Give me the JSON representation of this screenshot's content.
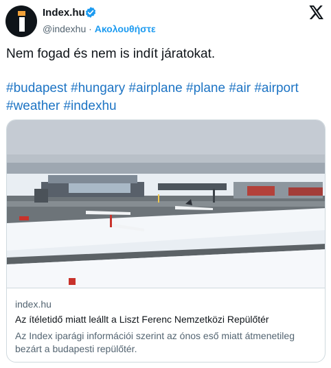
{
  "account": {
    "name": "Index.hu",
    "handle": "@indexhu",
    "separator": "·",
    "follow_label": "Ακολουθήστε",
    "verified_icon": "verified-badge-icon",
    "avatar_icon": "index-logo"
  },
  "brand": {
    "logo_icon": "x-logo-icon",
    "accent": "#1d9bf0",
    "text": "#0f1419",
    "muted": "#536471"
  },
  "tweet": {
    "text": "Nem fogad és nem is indít járatokat.",
    "hashtags": [
      "#budapest",
      "#hungary",
      "#airplane",
      "#plane",
      "#air",
      "#airport",
      "#weather",
      "#indexhu"
    ]
  },
  "card": {
    "domain": "index.hu",
    "title": "Az ítéletidő miatt leállt a Liszt Ferenc Nemzetközi Repülőtér",
    "description": "Az Index iparági információi szerint az ónos eső miatt átmenetileg bezárt a budapesti repülőtér."
  }
}
